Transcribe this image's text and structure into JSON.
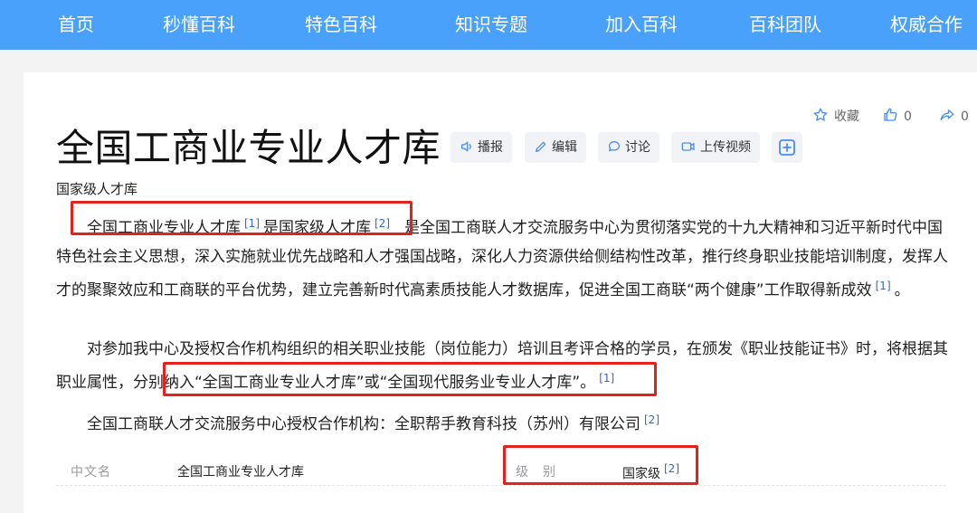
{
  "nav": {
    "items": [
      "首页",
      "秒懂百科",
      "特色百科",
      "知识专题",
      "加入百科",
      "百科团队",
      "权威合作"
    ]
  },
  "actions": {
    "favorite_label": "收藏",
    "like_count": "0",
    "share_count": "0"
  },
  "entry": {
    "title": "全国工商业专业人才库",
    "subtitle": "国家级人才库"
  },
  "toolbar": {
    "play_label": "播报",
    "edit_label": "编辑",
    "discuss_label": "讨论",
    "upload_video_label": "上传视频"
  },
  "paragraphs": {
    "p1": {
      "part1": "全国工商业专业人才库",
      "ref1": "[1]",
      "part2": "是国家级人才库",
      "ref2": "[2]",
      "part3": "是全国工商联人才交流服务中心为贯彻落实党的十九大精神和习近平新时代中国特色社会主义思想，深入实施就业优先战略和人才强国战略，深化人力资源供给侧结构性改革，推行终身职业技能培训制度，发挥人才的聚聚效应和工商联的平台优势，建立完善新时代高素质技能人才数据库，促进全国工商联“两个健康”工作取得新成效",
      "ref3": "[1]",
      "end": "。"
    },
    "p2": {
      "part1": "对参加我中心及授权合作机构组织的相关职业技能（岗位能力）培训且考评合格的学员，在颁发《职业技能证书》时，将根据其职业属性，",
      "part2": "分别纳入“全国工商业专业人才库”或“全国现代服务业专业人才库”。",
      "ref1": "[1]"
    },
    "p3": {
      "text": "全国工商联人才交流服务中心授权合作机构：全职帮手教育科技（苏州）有限公司",
      "ref1": "[2]"
    }
  },
  "infobox": {
    "label1": "中文名",
    "value1": "全国工商业专业人才库",
    "label2": "级　别",
    "value2": "国家级",
    "ref": "[2]"
  },
  "colors": {
    "nav_bg": "#4aa1fb",
    "highlight_box": "#e8201c",
    "ref_link": "#3366cc"
  }
}
